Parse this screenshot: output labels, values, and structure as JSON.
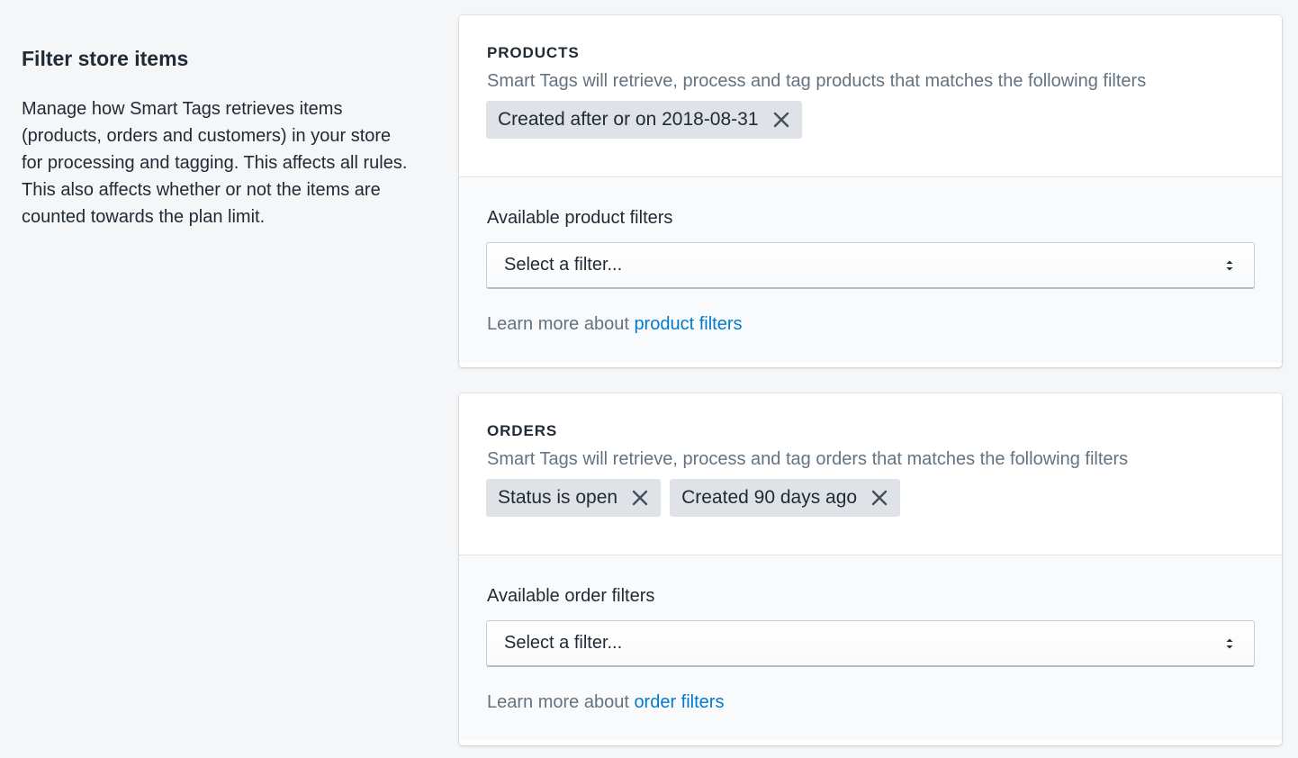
{
  "aside": {
    "title": "Filter store items",
    "description": "Manage how Smart Tags retrieves items (products, orders and customers) in your store for processing and tagging. This affects all rules. This also affects whether or not the items are counted towards the plan limit."
  },
  "products": {
    "heading": "PRODUCTS",
    "subtitle": "Smart Tags will retrieve, process and tag products that matches the following filters",
    "tags": [
      "Created after or on 2018-08-31"
    ],
    "filter_label": "Available product filters",
    "select_value": "Select a filter...",
    "learn_prefix": "Learn more about ",
    "learn_link": "product filters"
  },
  "orders": {
    "heading": "ORDERS",
    "subtitle": "Smart Tags will retrieve, process and tag orders that matches the following filters",
    "tags": [
      "Status is open",
      "Created 90 days ago"
    ],
    "filter_label": "Available order filters",
    "select_value": "Select a filter...",
    "learn_prefix": "Learn more about ",
    "learn_link": "order filters"
  },
  "icons": {
    "remove": "close-icon",
    "select": "select-arrows-icon"
  },
  "colors": {
    "background": "#f4f6f8",
    "card": "#ffffff",
    "tag": "#dfe3e8",
    "subdued_text": "#637381",
    "link": "#007ace",
    "text": "#212b36"
  }
}
